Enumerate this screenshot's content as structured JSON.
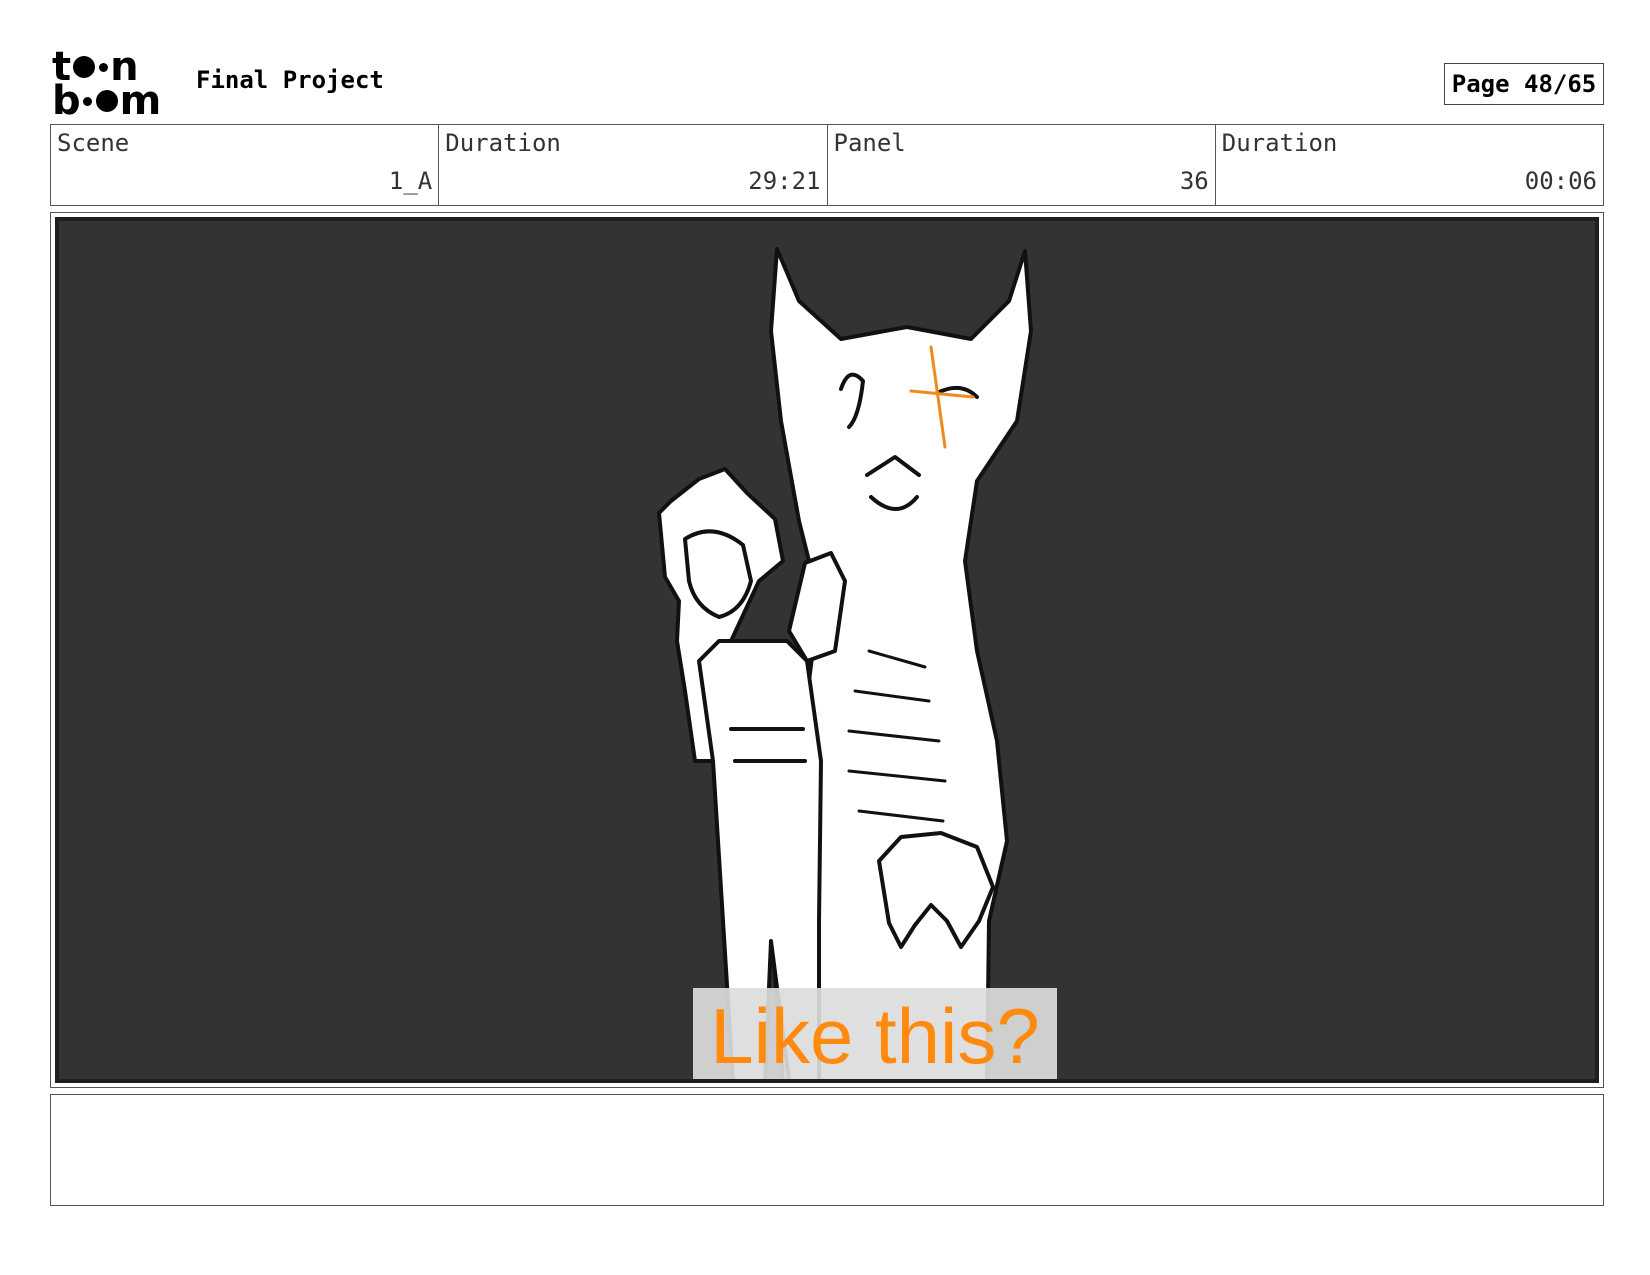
{
  "header": {
    "logo": {
      "line1": [
        "t",
        "n"
      ],
      "line2": [
        "b",
        "m"
      ]
    },
    "project_title": "Final Project",
    "page_label": "Page 48/65"
  },
  "info": {
    "scene_label": "Scene",
    "scene_value": "1_A",
    "duration_label": "Duration",
    "duration_value": "29:21",
    "panel_label": "Panel",
    "panel_value": "36",
    "panel_duration_label": "Duration",
    "panel_duration_value": "00:06"
  },
  "panel": {
    "caption": "Like this?",
    "caption_color": "#ff8a0d",
    "background_color": "#333333"
  },
  "notes": {
    "text": ""
  }
}
